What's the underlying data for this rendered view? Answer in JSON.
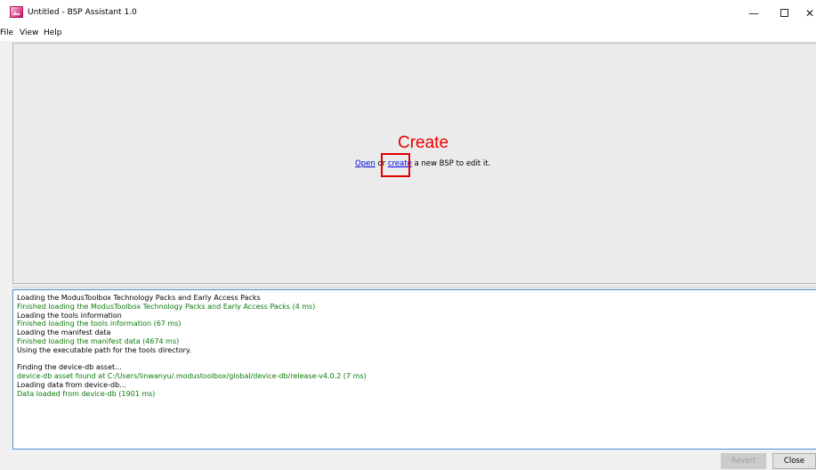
{
  "window": {
    "title": "Untitled - BSP Assistant 1.0",
    "minimize_glyph": "—",
    "close_glyph": "✕",
    "icon": "app-image-icon"
  },
  "menu": {
    "items": [
      "File",
      "View",
      "Help"
    ]
  },
  "main": {
    "annotation": "Create",
    "annotation_color": "#e80000",
    "open_link": "Open",
    "or_text": " or ",
    "create_link": "create",
    "tail_text": " a new BSP to edit it."
  },
  "log": {
    "lines": [
      {
        "text": "Loading the ModusToolbox Technology Packs and Early Access Packs",
        "status": "info"
      },
      {
        "text": "Finished loading the ModusToolbox Technology Packs and Early Access Packs (4 ms)",
        "status": "ok"
      },
      {
        "text": "Loading the tools information",
        "status": "info"
      },
      {
        "text": "Finished loading the tools information (67 ms)",
        "status": "ok"
      },
      {
        "text": "Loading the manifest data",
        "status": "info"
      },
      {
        "text": "Finished loading the manifest data (4674 ms)",
        "status": "ok"
      },
      {
        "text": "Using the executable path for the tools directory.",
        "status": "info"
      },
      {
        "text": "",
        "status": "info"
      },
      {
        "text": "Finding the device-db asset...",
        "status": "info"
      },
      {
        "text": "device-db asset found at C:/Users/linwanyu/.modustoolbox/global/device-db/release-v4.0.2 (7 ms)",
        "status": "ok"
      },
      {
        "text": "Loading data from device-db...",
        "status": "info"
      },
      {
        "text": "Data loaded from device-db (1901 ms)",
        "status": "ok"
      }
    ],
    "ok_color": "#0a7a0a"
  },
  "footer": {
    "revert_label": "Revert",
    "close_label": "Close"
  }
}
